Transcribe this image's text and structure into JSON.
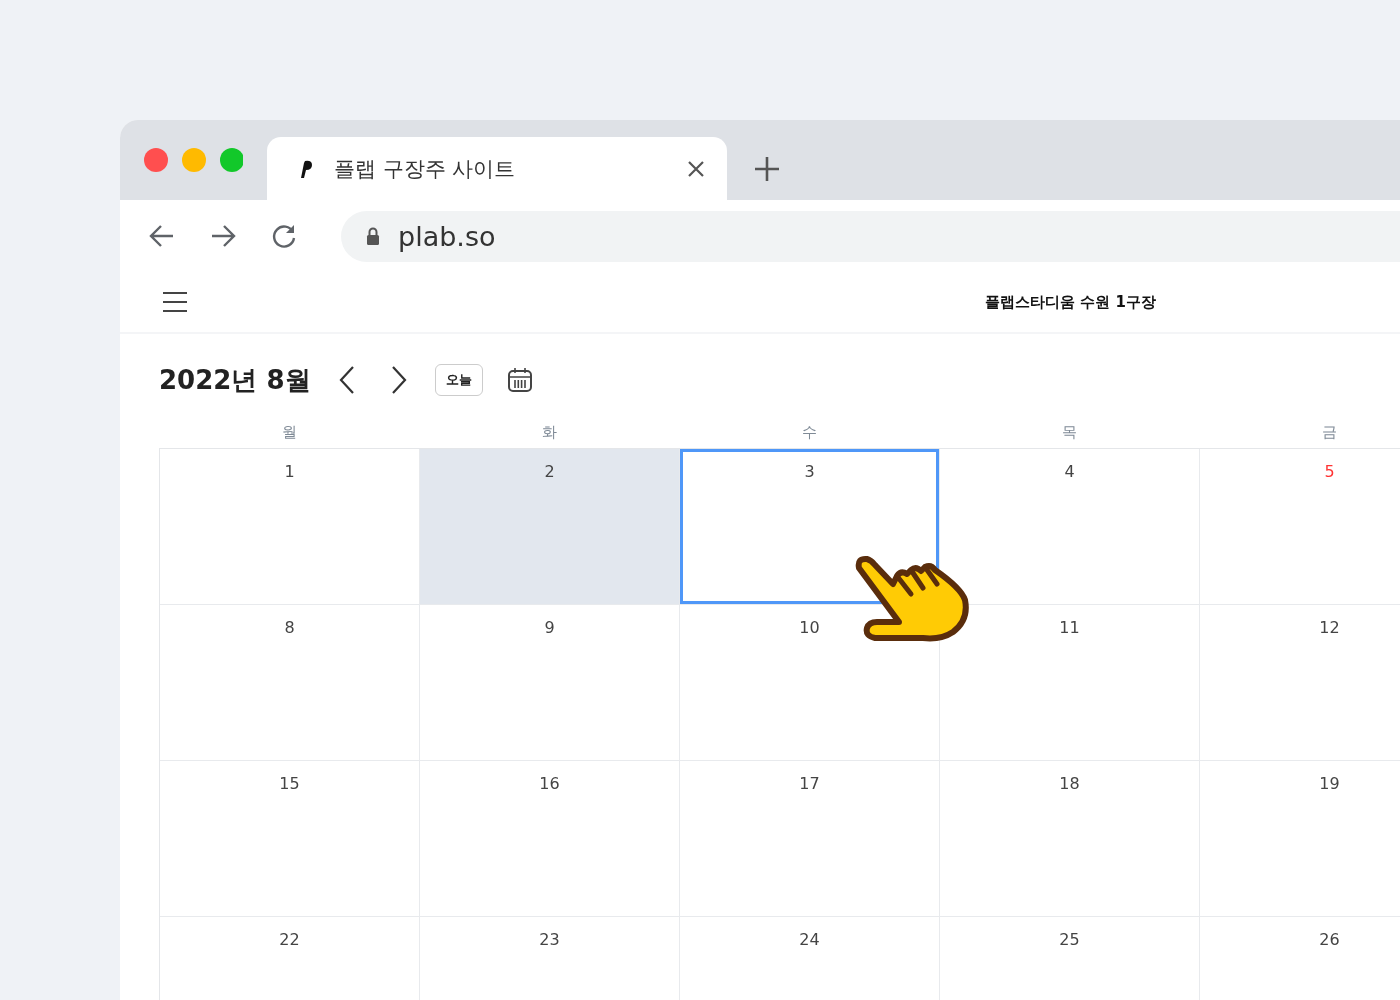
{
  "browser": {
    "tab": {
      "title": "플랩 구장주 사이트",
      "selected": true
    },
    "url": "plab.so"
  },
  "header": {
    "title": "플랩스타디움 수원 1구장"
  },
  "calendar": {
    "month": "2022년 8월",
    "today_button": "오늘",
    "weekdays": [
      "월",
      "화",
      "수",
      "목",
      "금"
    ],
    "weeks": [
      [
        {
          "day": "1",
          "selected": false,
          "today": false,
          "holiday": false
        },
        {
          "day": "2",
          "selected": false,
          "today": true,
          "holiday": false
        },
        {
          "day": "3",
          "selected": true,
          "today": false,
          "holiday": false
        },
        {
          "day": "4",
          "selected": false,
          "today": false,
          "holiday": false
        },
        {
          "day": "5",
          "selected": false,
          "today": false,
          "holiday": true
        }
      ],
      [
        {
          "day": "8",
          "selected": false,
          "today": false,
          "holiday": false
        },
        {
          "day": "9",
          "selected": false,
          "today": false,
          "holiday": false
        },
        {
          "day": "10",
          "selected": false,
          "today": false,
          "holiday": false
        },
        {
          "day": "11",
          "selected": false,
          "today": false,
          "holiday": false
        },
        {
          "day": "12",
          "selected": false,
          "today": false,
          "holiday": false
        }
      ],
      [
        {
          "day": "15",
          "selected": false,
          "today": false,
          "holiday": false
        },
        {
          "day": "16",
          "selected": false,
          "today": false,
          "holiday": false
        },
        {
          "day": "17",
          "selected": false,
          "today": false,
          "holiday": false
        },
        {
          "day": "18",
          "selected": false,
          "today": false,
          "holiday": false
        },
        {
          "day": "19",
          "selected": false,
          "today": false,
          "holiday": false
        }
      ],
      [
        {
          "day": "22",
          "selected": false,
          "today": false,
          "holiday": false
        },
        {
          "day": "23",
          "selected": false,
          "today": false,
          "holiday": false
        },
        {
          "day": "24",
          "selected": false,
          "today": false,
          "holiday": false
        },
        {
          "day": "25",
          "selected": false,
          "today": false,
          "holiday": false
        },
        {
          "day": "26",
          "selected": false,
          "today": false,
          "holiday": false
        }
      ]
    ]
  }
}
